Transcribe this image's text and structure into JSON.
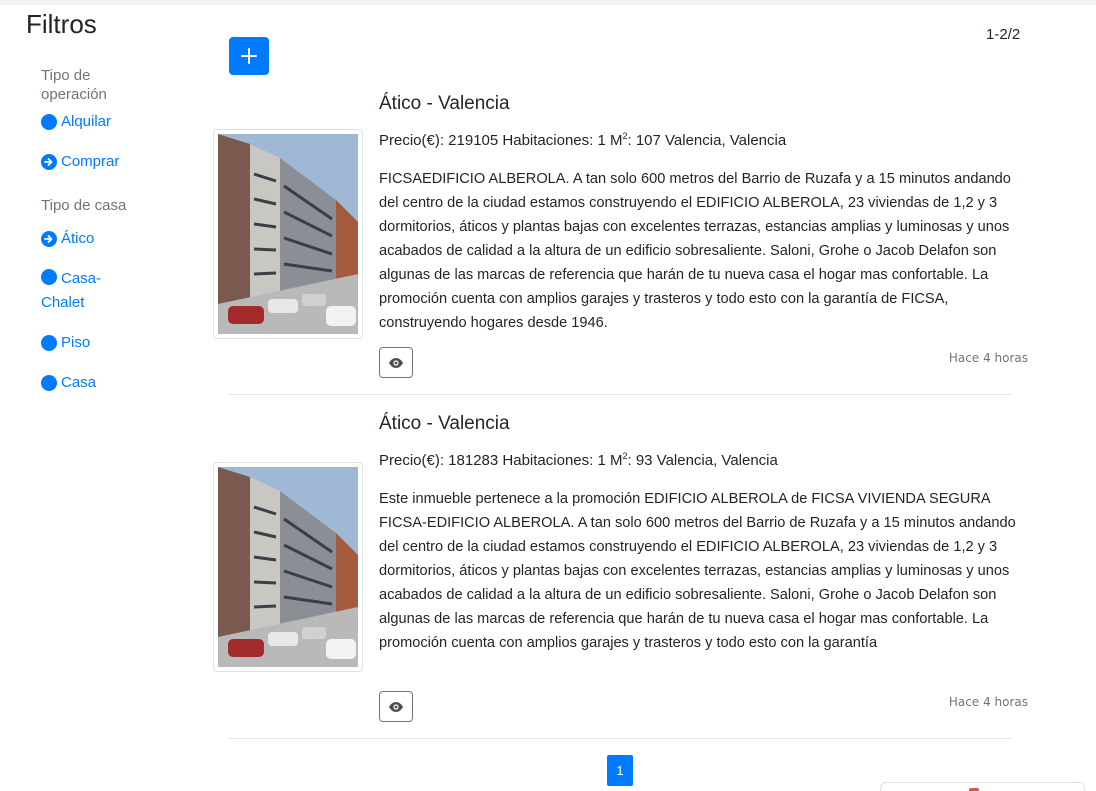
{
  "sidebar": {
    "title": "Filtros",
    "operation": {
      "label": "Tipo de operación",
      "items": [
        {
          "label": "Alquilar",
          "icon": "filled-circle-icon"
        },
        {
          "label": "Comprar",
          "icon": "arrow-circle-right-icon"
        }
      ]
    },
    "house": {
      "label": "Tipo de casa",
      "items": [
        {
          "label": "Ático",
          "icon": "arrow-circle-right-icon"
        },
        {
          "label": "Casa-Chalet",
          "icon": "filled-circle-icon"
        },
        {
          "label": "Piso",
          "icon": "filled-circle-icon"
        },
        {
          "label": "Casa",
          "icon": "filled-circle-icon"
        }
      ]
    }
  },
  "toolbar": {
    "add_icon": "plus-icon",
    "counter": "1-2/2"
  },
  "listings": [
    {
      "title": "Ático - Valencia",
      "meta_before_sup": "Precio(€): 219105 Habitaciones: 1 M",
      "meta_sup": "2",
      "meta_after_sup": ": 107 Valencia, Valencia",
      "description": "FICSAEDIFICIO ALBEROLA. A tan solo 600 metros del Barrio de Ruzafa y a 15 minutos andando del centro de la ciudad estamos construyendo el EDIFICIO ALBEROLA, 23 viviendas de 1,2 y 3 dormitorios, áticos y plantas bajas con excelentes terrazas, estancias amplias y luminosas y unos acabados de calidad a la altura de un edificio sobresaliente. Saloni, Grohe o Jacob Delafon son algunas de las marcas de referencia que harán de tu nueva casa el hogar mas confortable. La promoción cuenta con amplios garajes y trasteros y todo esto con la garantía de FICSA, construyendo hogares desde 1946.",
      "time": "Hace 4 horas",
      "view_icon": "eye-icon"
    },
    {
      "title": "Ático - Valencia",
      "meta_before_sup": "Precio(€): 181283 Habitaciones: 1 M",
      "meta_sup": "2",
      "meta_after_sup": ": 93 Valencia, Valencia",
      "description": "Este inmueble pertenece a la promoción EDIFICIO ALBEROLA de FICSA VIVIENDA SEGURA FICSA-EDIFICIO ALBEROLA. A tan solo 600 metros del Barrio de Ruzafa y a 15 minutos andando del centro de la ciudad estamos construyendo el EDIFICIO ALBEROLA, 23 viviendas de 1,2 y 3 dormitorios, áticos y plantas bajas con excelentes terrazas, estancias amplias y luminosas y unos acabados de calidad a la altura de un edificio sobresaliente. Saloni, Grohe o Jacob Delafon son algunas de las marcas de referencia que harán de tu nueva casa el hogar mas confortable. La promoción cuenta con amplios garajes y trasteros y todo esto con la garantía",
      "time": "Hace 4 horas",
      "view_icon": "eye-icon"
    }
  ],
  "pagination": {
    "current": "1"
  },
  "colors": {
    "primary": "#007bff",
    "muted": "#6c757d",
    "text": "#212529"
  }
}
